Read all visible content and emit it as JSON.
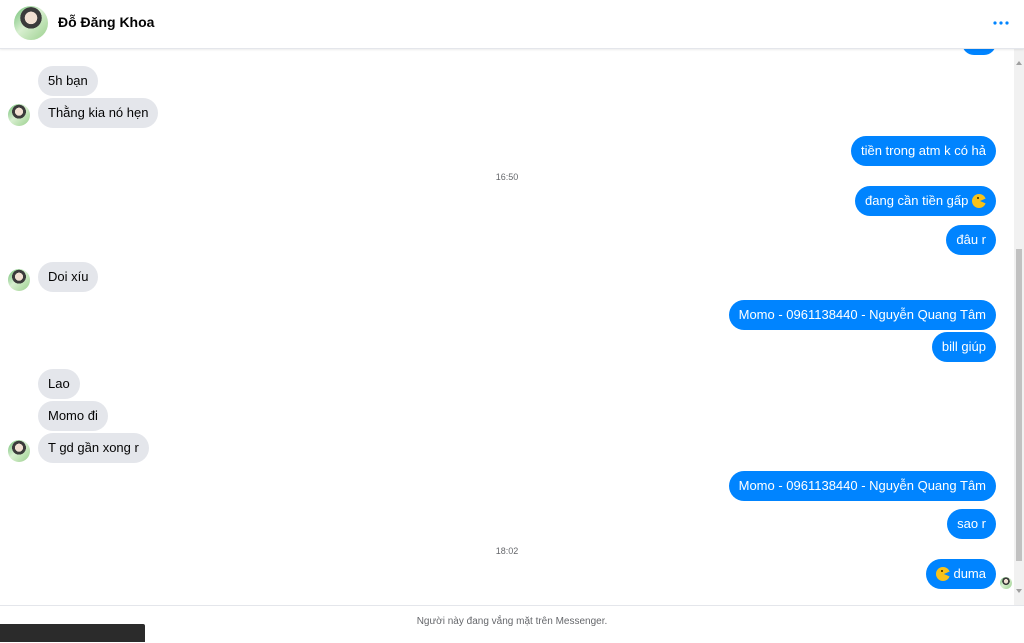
{
  "header": {
    "contact_name": "Đỗ Đăng Khoa"
  },
  "messages": {
    "in_1": "5h bạn",
    "in_2": "Thằng kia nó hẹn",
    "out_1": "tiền trong atm k có hả",
    "time_1": "16:50",
    "out_2": "đang cần tiền gấp",
    "out_3": "đâu r",
    "in_3": "Doi xíu",
    "out_4": "Momo - 0961138440 - Nguyễn Quang Tâm",
    "out_5": "bill giúp",
    "in_4": "Lao",
    "in_5": "Momo đi",
    "in_6": "T gd gần xong r",
    "out_6": "Momo - 0961138440 - Nguyễn Quang Tâm",
    "out_7": "sao r",
    "time_2": "18:02",
    "out_8": "duma"
  },
  "footer": {
    "status_text": "Người này đang vắng mặt trên Messenger."
  },
  "colors": {
    "outgoing_bubble": "#0084ff",
    "incoming_bubble": "#e4e6eb",
    "more_icon": "#0084ff"
  },
  "icons": {
    "more": "more-dots-icon",
    "emoji": "pacman-emoji-icon"
  }
}
